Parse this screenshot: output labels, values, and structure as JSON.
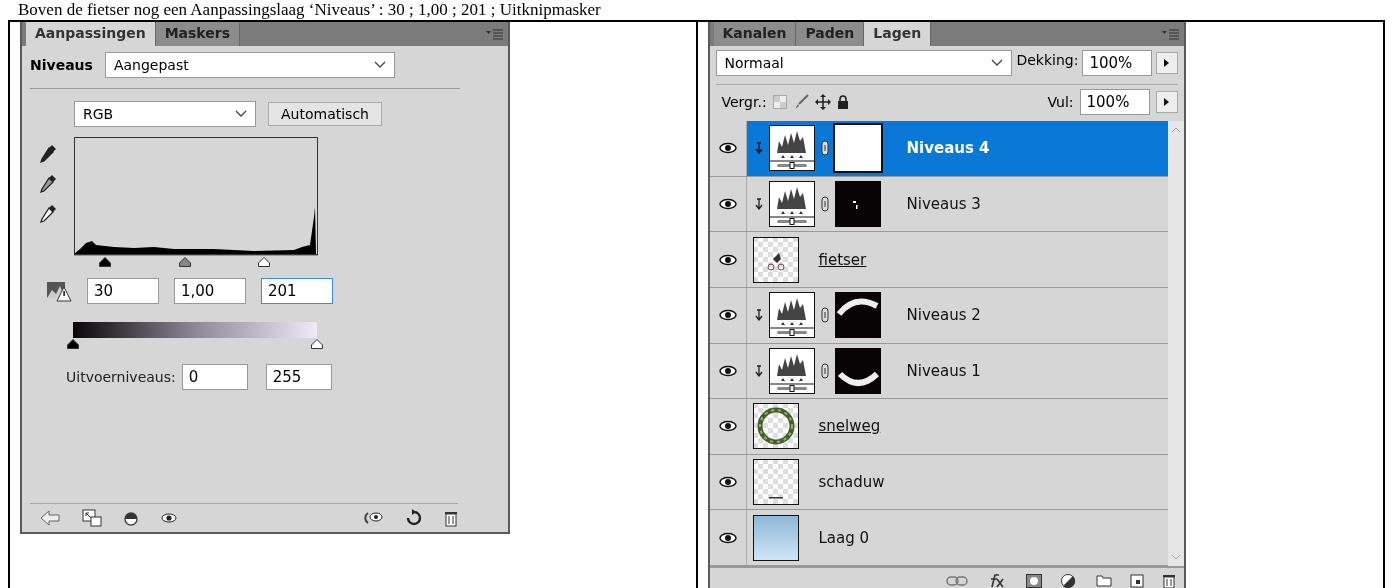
{
  "caption": "Boven de fietser nog een Aanpassingslaag ‘Niveaus’ : 30 ; 1,00 ; 201 ; Uitknipmasker",
  "adjustments_panel": {
    "tabs": [
      {
        "label": "Aanpassingen",
        "selected": true
      },
      {
        "label": "Maskers",
        "selected": false
      }
    ],
    "adjustment_label": "Niveaus",
    "preset": "Aangepast",
    "channel": "RGB",
    "auto_button": "Automatisch",
    "input_sliders": [
      {
        "kind": "black",
        "level": 0.127
      },
      {
        "kind": "gray",
        "level": 0.455
      },
      {
        "kind": "white",
        "level": 0.78
      }
    ],
    "input_values": [
      {
        "value": "30",
        "focused": false
      },
      {
        "value": "1,00",
        "focused": false
      },
      {
        "value": "201",
        "focused": true
      }
    ],
    "output_sliders": [
      {
        "kind": "black",
        "level": 0
      },
      {
        "kind": "white",
        "level": 1
      }
    ],
    "output_label": "Uitvoerniveaus:",
    "output_values": [
      "0",
      "255"
    ]
  },
  "layers_panel": {
    "tabs": [
      {
        "label": "Kanalen",
        "selected": false
      },
      {
        "label": "Paden",
        "selected": false
      },
      {
        "label": "Lagen",
        "selected": true
      }
    ],
    "blend_mode": "Normaal",
    "opacity_label": "Dekking:",
    "opacity": "100%",
    "lock_label": "Vergr.:",
    "fill_label": "Vul:",
    "fill": "100%",
    "layers": [
      {
        "name": "Niveaus 4",
        "kind": "adjustment",
        "mask": {
          "kind": "white"
        },
        "clipped": true,
        "visible": true,
        "selected": true,
        "underlined": false
      },
      {
        "name": "Niveaus 3",
        "kind": "adjustment",
        "mask": {
          "kind": "speck"
        },
        "clipped": true,
        "visible": true,
        "selected": false,
        "underlined": false
      },
      {
        "name": "fietser",
        "kind": "pixel",
        "thumbnail": {
          "kind": "cyclist"
        },
        "visible": true,
        "selected": false,
        "underlined": true
      },
      {
        "name": "Niveaus 2",
        "kind": "adjustment",
        "mask": {
          "kind": "arc"
        },
        "clipped": true,
        "visible": true,
        "selected": false,
        "underlined": false
      },
      {
        "name": "Niveaus 1",
        "kind": "adjustment",
        "mask": {
          "kind": "smile"
        },
        "clipped": true,
        "visible": true,
        "selected": false,
        "underlined": false
      },
      {
        "name": "snelweg",
        "kind": "pixel",
        "thumbnail": {
          "kind": "ring"
        },
        "visible": true,
        "selected": false,
        "underlined": true
      },
      {
        "name": "schaduw",
        "kind": "pixel",
        "thumbnail": {
          "kind": "empty"
        },
        "visible": true,
        "selected": false,
        "underlined": false
      },
      {
        "name": "Laag 0",
        "kind": "pixel",
        "thumbnail": {
          "kind": "sky"
        },
        "visible": true,
        "selected": false,
        "underlined": false
      }
    ]
  }
}
